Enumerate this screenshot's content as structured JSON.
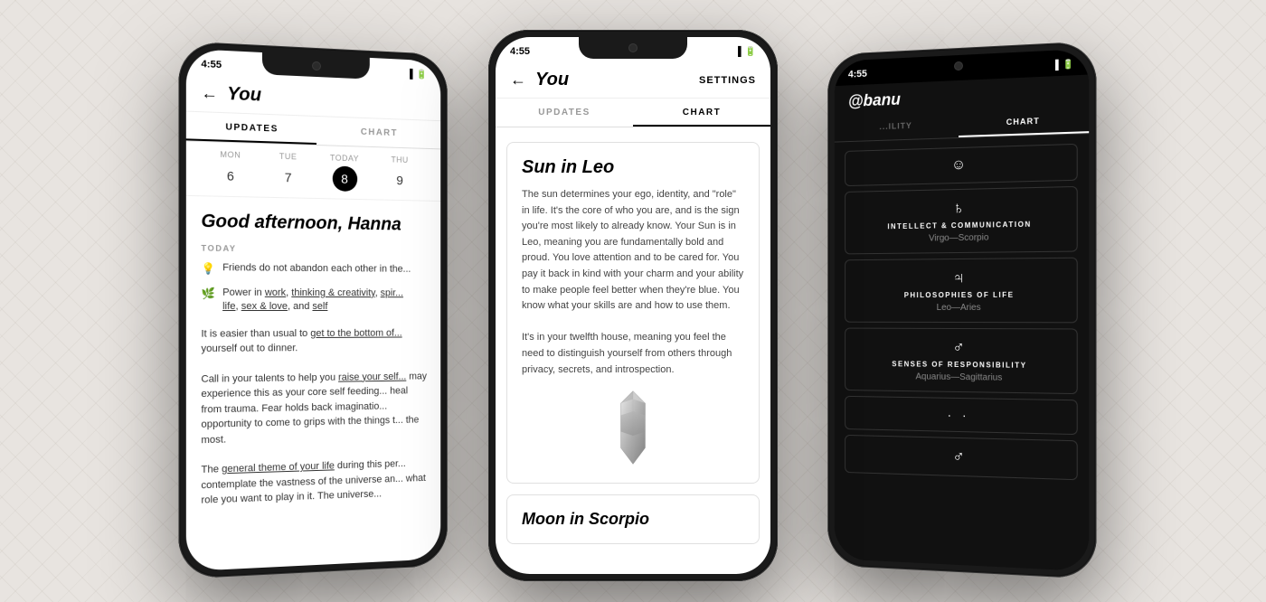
{
  "phones": {
    "left": {
      "status_time": "4:55",
      "title": "You",
      "tabs": [
        {
          "label": "UPDATES",
          "active": true
        },
        {
          "label": "CHART",
          "active": false
        }
      ],
      "calendar": {
        "days": [
          {
            "name": "MON",
            "num": "6",
            "today": false
          },
          {
            "name": "TUE",
            "num": "7",
            "today": false
          },
          {
            "name": "TODAY",
            "num": "8",
            "today": true
          },
          {
            "name": "THU",
            "num": "9",
            "today": false
          }
        ]
      },
      "greeting": "Good afternoon, Hanna",
      "today_label": "TODAY",
      "updates": [
        {
          "emoji": "💡",
          "text": "Friends do not abandon each other in the..."
        },
        {
          "emoji": "🌿",
          "text": "Power in work, thinking & creativity, spir... life, sex & love, and self"
        }
      ],
      "body_paragraphs": [
        "It is easier than usual to get to the bottom of... yourself out to dinner.",
        "Call in your talents to help you raise your self... may experience this as your core self feeding... heal from trauma. Fear holds back imaginatio... opportunity to come to grips with the things t... the most.",
        "The general theme of your life during this per... contemplate the vastness of the universe an... what role you want to play in it. The universe..."
      ]
    },
    "center": {
      "status_time": "4:55",
      "title": "You",
      "settings_label": "SETTINGS",
      "tabs": [
        {
          "label": "UPDATES",
          "active": false
        },
        {
          "label": "CHART",
          "active": true
        }
      ],
      "cards": [
        {
          "title": "Sun in Leo",
          "body": "The sun determines your ego, identity, and \"role\" in life. It's the core of who you are, and is the sign you're most likely to already know. Your Sun is in Leo, meaning you are fundamentally bold and proud. You love attention and to be cared for. You pay it back in kind with your charm and your ability to make people feel better when they're blue. You know what your skills are and how to use them.",
          "body2": "It's in your twelfth house, meaning you feel the need to distinguish yourself from others through privacy, secrets, and introspection.",
          "has_crystal": true
        },
        {
          "title": "Moon in Scorpio",
          "body": ""
        }
      ]
    },
    "right": {
      "status_time": "4:55",
      "username": "@banu",
      "tabs": [
        {
          "label": "...ILITY",
          "active": false
        },
        {
          "label": "CHART",
          "active": true
        }
      ],
      "chart_rows": [
        {
          "symbol": "☺",
          "category": "",
          "signs": ""
        },
        {
          "symbol": "♄",
          "category": "INTELLECT & COMMUNICATION",
          "signs": "Virgo—Scorpio"
        },
        {
          "symbol": "♃",
          "category": "PHILOSOPHIES OF LIFE",
          "signs": "Leo—Aries"
        },
        {
          "symbol": "♂",
          "category": "SENSES OF RESPONSIBILITY",
          "signs": "Aquarius—Sagittarius"
        },
        {
          "symbol": "·  ·",
          "category": "",
          "signs": ""
        },
        {
          "symbol": "♂",
          "category": "",
          "signs": ""
        }
      ]
    }
  }
}
